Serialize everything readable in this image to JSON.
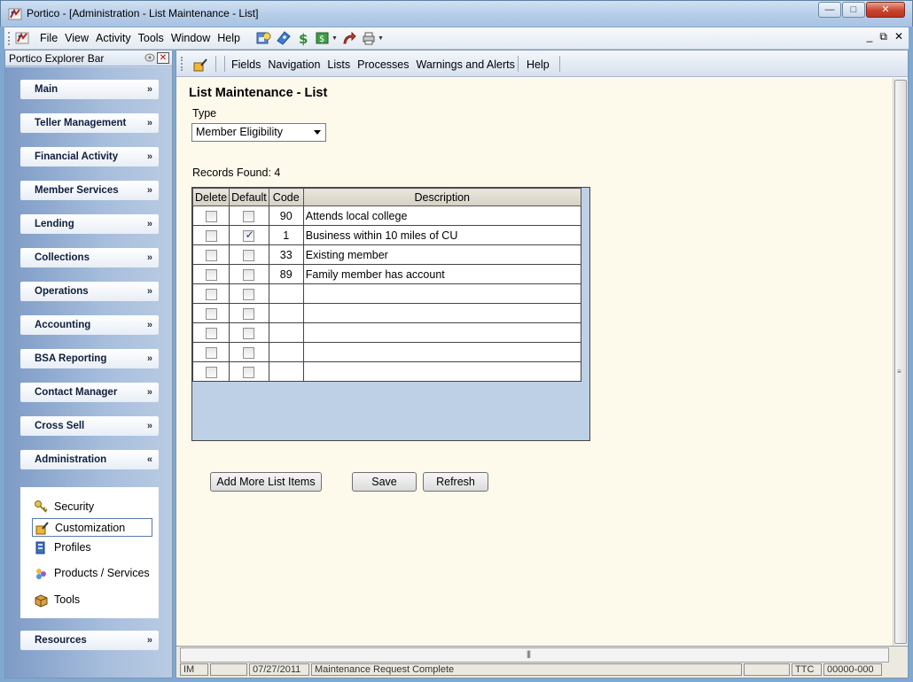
{
  "window": {
    "title": "Portico - [Administration - List Maintenance - List]",
    "minimize": "—",
    "maximize": "□",
    "close": "✕"
  },
  "menubar": {
    "items": [
      "File",
      "View",
      "Activity",
      "Tools",
      "Window",
      "Help"
    ],
    "mdi_controls": [
      "_",
      "⧉",
      "✕"
    ]
  },
  "explorer": {
    "title": "Portico Explorer Bar",
    "sections": [
      {
        "label": "Main",
        "chevron": "»"
      },
      {
        "label": "Teller Management",
        "chevron": "»"
      },
      {
        "label": "Financial Activity",
        "chevron": "»"
      },
      {
        "label": "Member Services",
        "chevron": "»"
      },
      {
        "label": "Lending",
        "chevron": "»"
      },
      {
        "label": "Collections",
        "chevron": "»"
      },
      {
        "label": "Operations",
        "chevron": "»"
      },
      {
        "label": "Accounting",
        "chevron": "»"
      },
      {
        "label": "BSA Reporting",
        "chevron": "»"
      },
      {
        "label": "Contact Manager",
        "chevron": "»"
      },
      {
        "label": "Cross Sell",
        "chevron": "»"
      },
      {
        "label": "Administration",
        "chevron": "«"
      },
      {
        "label": "Resources",
        "chevron": "»"
      }
    ],
    "admin_items": [
      {
        "label": "Security",
        "icon": "keys-icon"
      },
      {
        "label": "Customization",
        "icon": "customization-icon"
      },
      {
        "label": "Profiles",
        "icon": "profiles-icon"
      },
      {
        "label": "Products / Services",
        "icon": "products-icon"
      },
      {
        "label": "Tools",
        "icon": "toolbox-icon"
      }
    ]
  },
  "child_menu": {
    "items": [
      "Fields",
      "Navigation",
      "Lists",
      "Processes",
      "Warnings and Alerts"
    ],
    "help": "Help"
  },
  "page": {
    "title": "List Maintenance - List",
    "type_label": "Type",
    "type_value": "Member Eligibility",
    "records_label": "Records Found:",
    "records_count": "4"
  },
  "grid": {
    "headers": {
      "delete": "Delete",
      "default": "Default",
      "code": "Code",
      "description": "Description"
    },
    "rows": [
      {
        "code": "90",
        "description": "Attends local college",
        "delete": false,
        "default": false
      },
      {
        "code": "1",
        "description": "Business within 10 miles of CU",
        "delete": false,
        "default": true
      },
      {
        "code": "33",
        "description": "Existing member",
        "delete": false,
        "default": false
      },
      {
        "code": "89",
        "description": "Family member has account",
        "delete": false,
        "default": false
      },
      {
        "code": "",
        "description": "",
        "delete": false,
        "default": false
      },
      {
        "code": "",
        "description": "",
        "delete": false,
        "default": false
      },
      {
        "code": "",
        "description": "",
        "delete": false,
        "default": false
      },
      {
        "code": "",
        "description": "",
        "delete": false,
        "default": false
      },
      {
        "code": "",
        "description": "",
        "delete": false,
        "default": false
      }
    ]
  },
  "buttons": {
    "add_more": "Add More List Items",
    "save": "Save",
    "refresh": "Refresh"
  },
  "statusbar": {
    "panels": [
      "IM",
      "",
      "07/27/2011",
      "Maintenance Request Complete",
      "",
      "TTC",
      "00000-000"
    ]
  }
}
